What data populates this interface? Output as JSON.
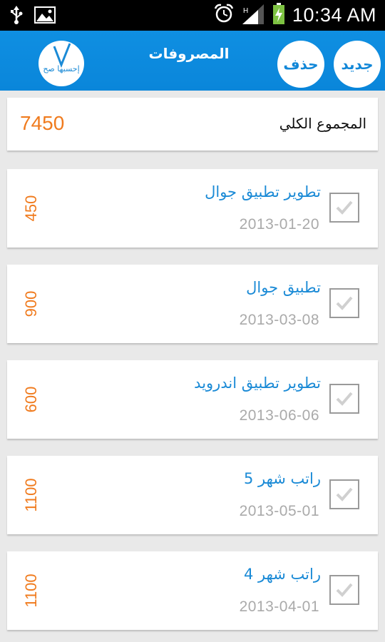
{
  "status_bar": {
    "time": "10:34 AM",
    "left_icons": [
      "usb-icon",
      "image-icon"
    ],
    "right_icons": [
      "alarm-icon",
      "signal-icon",
      "battery-charging-icon"
    ]
  },
  "action_bar": {
    "logo_text": "إحسبها صح",
    "title": "المصروفات",
    "delete_label": "حذف",
    "new_label": "جديد"
  },
  "total": {
    "label": "المجموع الكلي",
    "value": "7450"
  },
  "expenses": [
    {
      "title": "تطوير تطبيق جوال",
      "date": "2013-01-20",
      "amount": "450"
    },
    {
      "title": "تطبيق جوال",
      "date": "2013-03-08",
      "amount": "900"
    },
    {
      "title": "تطوير تطبيق اندرويد",
      "date": "2013-06-06",
      "amount": "600"
    },
    {
      "title": "راتب شهر 5",
      "date": "2013-05-01",
      "amount": "1100"
    },
    {
      "title": "راتب شهر 4",
      "date": "2013-04-01",
      "amount": "1100"
    }
  ],
  "colors": {
    "accent": "#0a86da",
    "amount": "#f07b1e",
    "title": "#1a8ad6",
    "date": "#aaaaaa"
  }
}
